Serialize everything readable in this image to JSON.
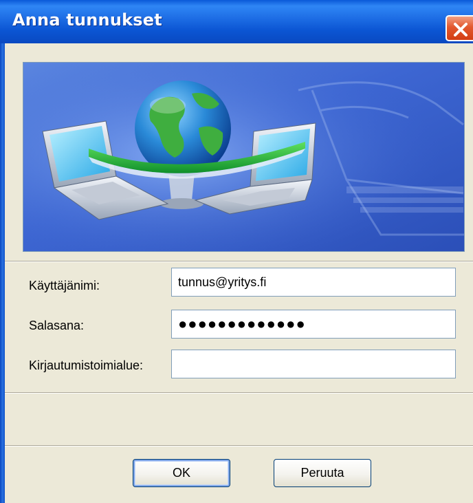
{
  "window": {
    "title": "Anna tunnukset",
    "close_icon": "close-icon"
  },
  "banner": {
    "illustration": "network-globe-laptops-illustration"
  },
  "form": {
    "username_label": "Käyttäjänimi:",
    "username_value": "tunnus@yritys.fi",
    "password_label": "Salasana:",
    "password_value": "●●●●●●●●●●●●●",
    "domain_label": "Kirjautumistoimialue:",
    "domain_value": ""
  },
  "buttons": {
    "ok_label": "OK",
    "cancel_label": "Peruuta"
  },
  "colors": {
    "titlebar": "#0a59d8",
    "dialog_background": "#ece9d8",
    "close_button": "#e2582e",
    "banner_blue": "#3f6fd6"
  }
}
